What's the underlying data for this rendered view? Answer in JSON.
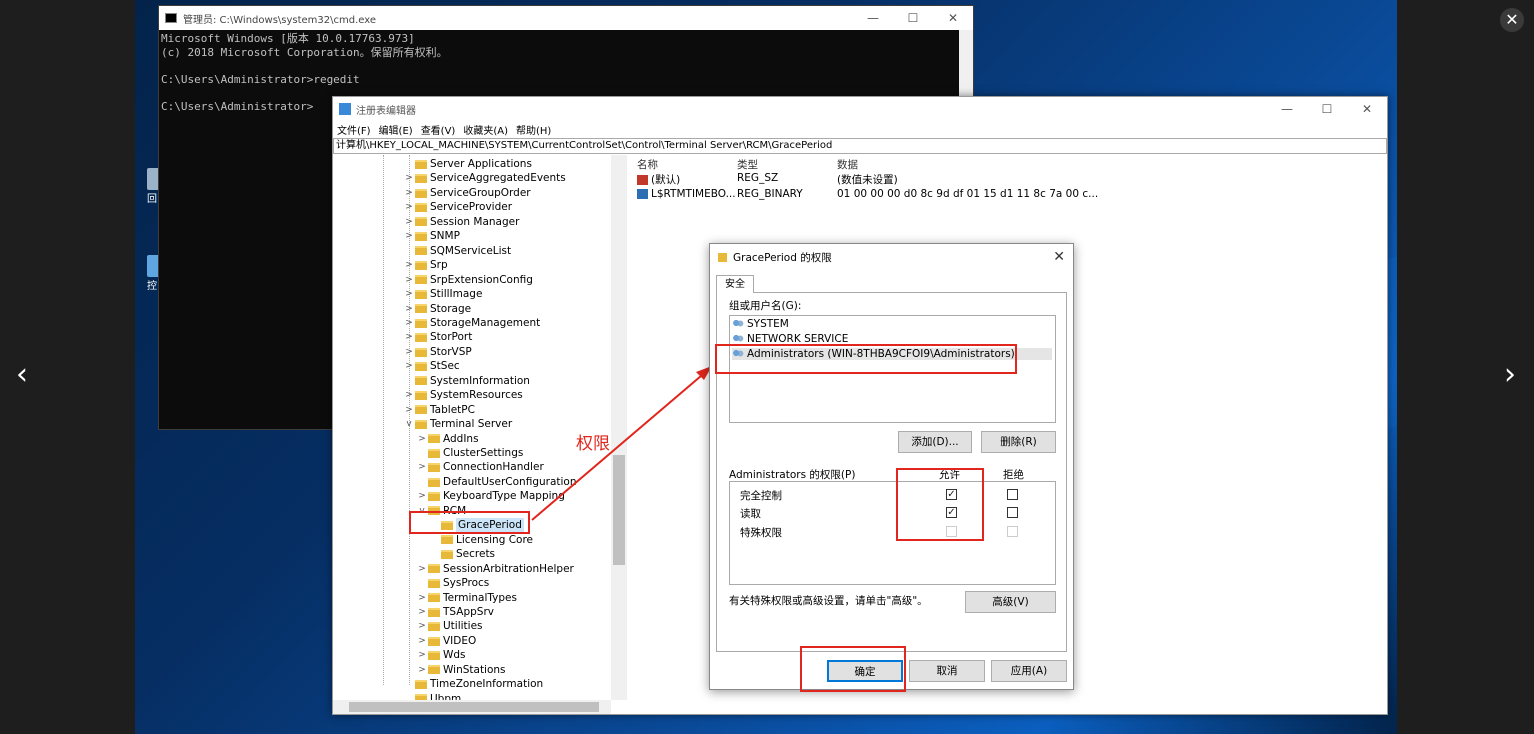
{
  "viewer": {
    "prev_glyph": "‹",
    "next_glyph": "›",
    "close_glyph": "✕"
  },
  "desktop_icons": [
    {
      "label": "回",
      "icon": "recycle-bin-icon"
    },
    {
      "label": "控",
      "icon": "control-panel-icon"
    }
  ],
  "cmd": {
    "title": "管理员: C:\\Windows\\system32\\cmd.exe",
    "lines": [
      "Microsoft Windows [版本 10.0.17763.973]",
      "(c) 2018 Microsoft Corporation。保留所有权利。",
      "",
      "C:\\Users\\Administrator>regedit",
      "",
      "C:\\Users\\Administrator>"
    ]
  },
  "regedit": {
    "title": "注册表编辑器",
    "menu": [
      "文件(F)",
      "编辑(E)",
      "查看(V)",
      "收藏夹(A)",
      "帮助(H)"
    ],
    "address": "计算机\\HKEY_LOCAL_MACHINE\\SYSTEM\\CurrentControlSet\\Control\\Terminal Server\\RCM\\GracePeriod",
    "tree": [
      {
        "label": "Server Applications",
        "level": 0,
        "exp": ""
      },
      {
        "label": "ServiceAggregatedEvents",
        "level": 0,
        "exp": ">"
      },
      {
        "label": "ServiceGroupOrder",
        "level": 0,
        "exp": ">"
      },
      {
        "label": "ServiceProvider",
        "level": 0,
        "exp": ">"
      },
      {
        "label": "Session Manager",
        "level": 0,
        "exp": ">"
      },
      {
        "label": "SNMP",
        "level": 0,
        "exp": ">"
      },
      {
        "label": "SQMServiceList",
        "level": 0,
        "exp": ""
      },
      {
        "label": "Srp",
        "level": 0,
        "exp": ">"
      },
      {
        "label": "SrpExtensionConfig",
        "level": 0,
        "exp": ">"
      },
      {
        "label": "StillImage",
        "level": 0,
        "exp": ">"
      },
      {
        "label": "Storage",
        "level": 0,
        "exp": ">"
      },
      {
        "label": "StorageManagement",
        "level": 0,
        "exp": ">"
      },
      {
        "label": "StorPort",
        "level": 0,
        "exp": ">"
      },
      {
        "label": "StorVSP",
        "level": 0,
        "exp": ">"
      },
      {
        "label": "StSec",
        "level": 0,
        "exp": ">"
      },
      {
        "label": "SystemInformation",
        "level": 0,
        "exp": ""
      },
      {
        "label": "SystemResources",
        "level": 0,
        "exp": ">"
      },
      {
        "label": "TabletPC",
        "level": 0,
        "exp": ">"
      },
      {
        "label": "Terminal Server",
        "level": 0,
        "exp": "v"
      },
      {
        "label": "AddIns",
        "level": 1,
        "exp": ">"
      },
      {
        "label": "ClusterSettings",
        "level": 1,
        "exp": ""
      },
      {
        "label": "ConnectionHandler",
        "level": 1,
        "exp": ">"
      },
      {
        "label": "DefaultUserConfiguration",
        "level": 1,
        "exp": ""
      },
      {
        "label": "KeyboardType Mapping",
        "level": 1,
        "exp": ">"
      },
      {
        "label": "RCM",
        "level": 1,
        "exp": "v"
      },
      {
        "label": "GracePeriod",
        "level": 2,
        "exp": "",
        "selected": true
      },
      {
        "label": "Licensing Core",
        "level": 2,
        "exp": ""
      },
      {
        "label": "Secrets",
        "level": 2,
        "exp": ""
      },
      {
        "label": "SessionArbitrationHelper",
        "level": 1,
        "exp": ">"
      },
      {
        "label": "SysProcs",
        "level": 1,
        "exp": ""
      },
      {
        "label": "TerminalTypes",
        "level": 1,
        "exp": ">"
      },
      {
        "label": "TSAppSrv",
        "level": 1,
        "exp": ">"
      },
      {
        "label": "Utilities",
        "level": 1,
        "exp": ">"
      },
      {
        "label": "VIDEO",
        "level": 1,
        "exp": ">"
      },
      {
        "label": "Wds",
        "level": 1,
        "exp": ">"
      },
      {
        "label": "WinStations",
        "level": 1,
        "exp": ">"
      },
      {
        "label": "TimeZoneInformation",
        "level": 0,
        "exp": ""
      },
      {
        "label": "Ubpm",
        "level": 0,
        "exp": ""
      }
    ],
    "columns": {
      "name": "名称",
      "type": "类型",
      "data": "数据"
    },
    "values": [
      {
        "name": "(默认)",
        "type": "REG_SZ",
        "data": "(数值未设置)",
        "icon": "string-value-icon"
      },
      {
        "name": "L$RTMTIMEBO...",
        "type": "REG_BINARY",
        "data": "01 00 00 00 d0 8c 9d df 01 15 d1 11 8c 7a 00 c...",
        "icon": "binary-value-icon"
      }
    ]
  },
  "annotation": {
    "label": "权限",
    "color": "#e0261d"
  },
  "perm_dialog": {
    "title": "GracePeriod 的权限",
    "tab": "安全",
    "group_label": "组或用户名(G):",
    "users": [
      "SYSTEM",
      "NETWORK SERVICE",
      "Administrators (WIN-8THBA9CFOI9\\Administrators)"
    ],
    "add_button": "添加(D)...",
    "remove_button": "删除(R)",
    "perm_label": "Administrators 的权限(P)",
    "allow_header": "允许",
    "deny_header": "拒绝",
    "permissions": [
      {
        "name": "完全控制",
        "allow": true,
        "deny": false
      },
      {
        "name": "读取",
        "allow": true,
        "deny": false
      },
      {
        "name": "特殊权限",
        "allow": false,
        "deny": false,
        "disabled": true
      }
    ],
    "advanced_hint": "有关特殊权限或高级设置，请单击\"高级\"。",
    "advanced_button": "高级(V)",
    "ok_button": "确定",
    "cancel_button": "取消",
    "apply_button": "应用(A)"
  }
}
